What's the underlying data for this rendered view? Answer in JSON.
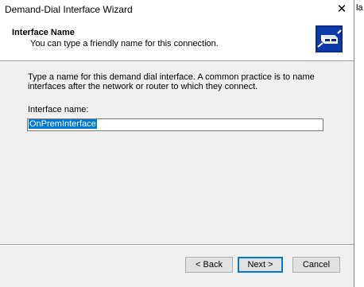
{
  "window": {
    "title": "Demand-Dial Interface Wizard",
    "close_glyph": "✕",
    "behind_text": "la"
  },
  "header": {
    "title": "Interface Name",
    "subtitle": "You can type a friendly name for this connection.",
    "icon": "network-interface-icon"
  },
  "body": {
    "description": "Type a name for this demand dial interface.  A common practice is to name interfaces after the network or router to which they connect.",
    "field_label": "Interface name:",
    "field_value": "OnPremInterface"
  },
  "buttons": {
    "back": "< Back",
    "next": "Next >",
    "cancel": "Cancel"
  },
  "colors": {
    "selection": "#0078d7",
    "header_icon_bg": "#0a2a8a"
  }
}
